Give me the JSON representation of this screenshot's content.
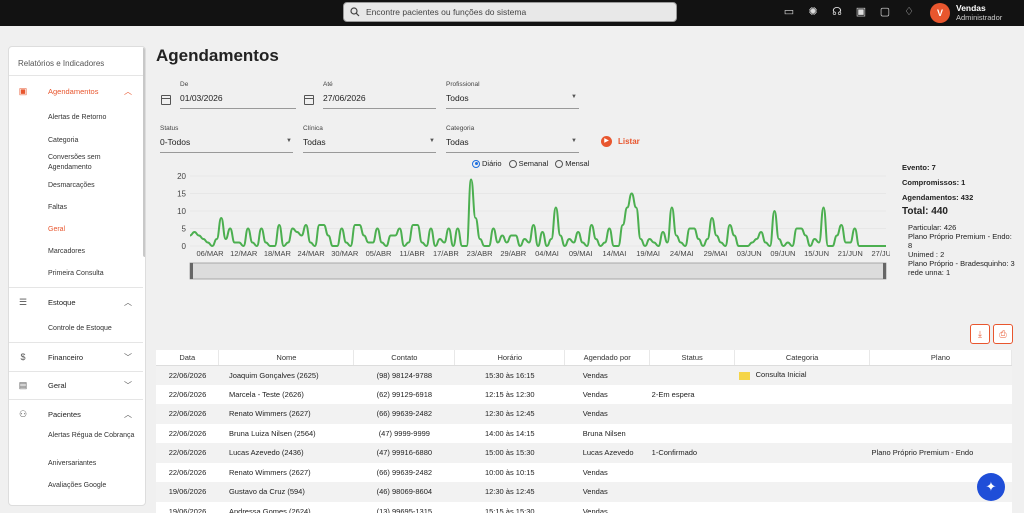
{
  "topbar": {
    "search_placeholder": "Encontre pacientes ou funções do sistema",
    "icons": [
      "video-icon",
      "sun-icon",
      "headset-icon",
      "calendar-icon",
      "chat-icon",
      "bell-icon"
    ],
    "user": {
      "initial": "V",
      "name": "Vendas",
      "role": "Administrador"
    }
  },
  "sidebar": {
    "title": "Relatórios e Indicadores",
    "groups": [
      {
        "label": "Agendamentos",
        "icon": "calendar-icon",
        "expanded": true,
        "active": true,
        "items": [
          "Alertas de Retorno",
          "Categoria",
          "Conversões sem Agendamento",
          "Desmarcações",
          "Faltas",
          "Geral",
          "Marcadores",
          "Primeira Consulta"
        ],
        "active_item": "Geral"
      },
      {
        "label": "Estoque",
        "icon": "list-icon",
        "expanded": true,
        "items": [
          "Controle de Estoque"
        ]
      },
      {
        "label": "Financeiro",
        "icon": "dollar-icon",
        "expanded": false
      },
      {
        "label": "Geral",
        "icon": "card-icon",
        "expanded": false
      },
      {
        "label": "Pacientes",
        "icon": "people-icon",
        "expanded": true,
        "items": [
          "Alertas Régua de Cobrança",
          "Aniversariantes",
          "Avaliações Google"
        ]
      }
    ]
  },
  "page": {
    "title": "Agendamentos"
  },
  "filters": {
    "de": {
      "label": "De",
      "value": "01/03/2026"
    },
    "ate": {
      "label": "Até",
      "value": "27/06/2026"
    },
    "profissional": {
      "label": "Profissional",
      "value": "Todos"
    },
    "status": {
      "label": "Status",
      "value": "0-Todos"
    },
    "clinica": {
      "label": "Clínica",
      "value": "Todas"
    },
    "categoria": {
      "label": "Categoria",
      "value": "Todas"
    },
    "listar": "Listar"
  },
  "view_options": {
    "options": [
      "Diário",
      "Semanal",
      "Mensal"
    ],
    "selected": "Diário"
  },
  "chart_data": {
    "type": "line",
    "x_labels": [
      "06/MAR",
      "12/MAR",
      "18/MAR",
      "24/MAR",
      "30/MAR",
      "05/ABR",
      "11/ABR",
      "17/ABR",
      "23/ABR",
      "29/ABR",
      "04/MAI",
      "09/MAI",
      "14/MAI",
      "19/MAI",
      "24/MAI",
      "29/MAI",
      "03/JUN",
      "09/JUN",
      "15/JUN",
      "21/JUN",
      "27/JUN"
    ],
    "ylim": [
      0,
      20
    ],
    "y_ticks": [
      0,
      5,
      10,
      15,
      20
    ],
    "color": "#4caf50",
    "values": [
      3,
      4,
      3,
      2,
      1,
      0,
      2,
      8,
      2,
      5,
      1,
      1,
      0,
      5,
      1,
      0,
      5,
      1,
      0,
      0,
      6,
      0,
      1,
      5,
      4,
      3,
      6,
      1,
      0,
      6,
      6,
      3,
      0,
      0,
      5,
      1,
      0,
      6,
      6,
      3,
      1,
      1,
      5,
      1,
      0,
      3,
      3,
      5,
      0,
      1,
      6,
      6,
      1,
      0,
      5,
      0,
      2,
      1,
      5,
      0,
      5,
      0,
      0,
      19,
      8,
      2,
      0,
      0,
      5,
      1,
      3,
      1,
      3,
      3,
      0,
      2,
      1,
      6,
      0,
      4,
      0,
      2,
      11,
      3,
      0,
      2,
      1,
      4,
      1,
      0,
      6,
      2,
      0,
      1,
      5,
      0,
      0,
      6,
      11,
      15,
      11,
      2,
      0,
      2,
      1,
      0,
      4,
      1,
      11,
      3,
      1,
      0,
      5,
      5,
      2,
      0,
      2,
      8,
      3,
      1,
      0,
      6,
      3,
      0,
      0,
      0,
      1,
      2,
      4,
      1,
      0,
      10,
      2,
      0,
      1,
      0,
      5,
      5,
      3,
      0,
      2,
      1,
      11,
      0,
      0,
      3,
      6,
      1,
      1,
      5,
      0,
      0,
      0,
      0,
      0,
      0,
      0
    ]
  },
  "summary": {
    "lines": [
      "Evento: 7",
      "Compromissos: 1",
      "Agendamentos: 432"
    ],
    "total": "Total: 440",
    "details": [
      "Particular: 426",
      "Plano Próprio Premium - Endo: 8",
      "Unimed : 2",
      "Plano Próprio - Bradesquinho: 3",
      "rede unna: 1"
    ]
  },
  "table": {
    "columns": [
      "Data",
      "Nome",
      "Contato",
      "Horário",
      "Agendado por",
      "Status",
      "Categoria",
      "Plano"
    ],
    "rows": [
      [
        "22/06/2026",
        "Joaquim Gonçalves (2625)",
        "(98) 98124-9788",
        "15:30 às 16:15",
        "Vendas",
        "",
        "Consulta Inicial",
        ""
      ],
      [
        "22/06/2026",
        "Marcela - Teste (2626)",
        "(62) 99129-6918",
        "12:15 às 12:30",
        "Vendas",
        "2-Em espera",
        "",
        ""
      ],
      [
        "22/06/2026",
        "Renato Wimmers (2627)",
        "(66) 99639-2482",
        "12:30 às 12:45",
        "Vendas",
        "",
        "",
        ""
      ],
      [
        "22/06/2026",
        "Bruna Luiza Nilsen (2564)",
        "(47) 9999-9999",
        "14:00 às 14:15",
        "Bruna Nilsen",
        "",
        "",
        ""
      ],
      [
        "22/06/2026",
        "Lucas Azevedo (2436)",
        "(47) 99916-6880",
        "15:00 às 15:30",
        "Lucas Azevedo",
        "1-Confirmado",
        "",
        "Plano Próprio Premium - Endo"
      ],
      [
        "22/06/2026",
        "Renato Wimmers (2627)",
        "(66) 99639-2482",
        "10:00 às 10:15",
        "Vendas",
        "",
        "",
        ""
      ],
      [
        "19/06/2026",
        "Gustavo da Cruz (594)",
        "(46) 98069-8604",
        "12:30 às 12:45",
        "Vendas",
        "",
        "",
        ""
      ],
      [
        "19/06/2026",
        "Andressa Gomes (2624)",
        "(13) 99695-1315",
        "15:15 às 15:30",
        "Vendas",
        "",
        "",
        ""
      ]
    ]
  }
}
